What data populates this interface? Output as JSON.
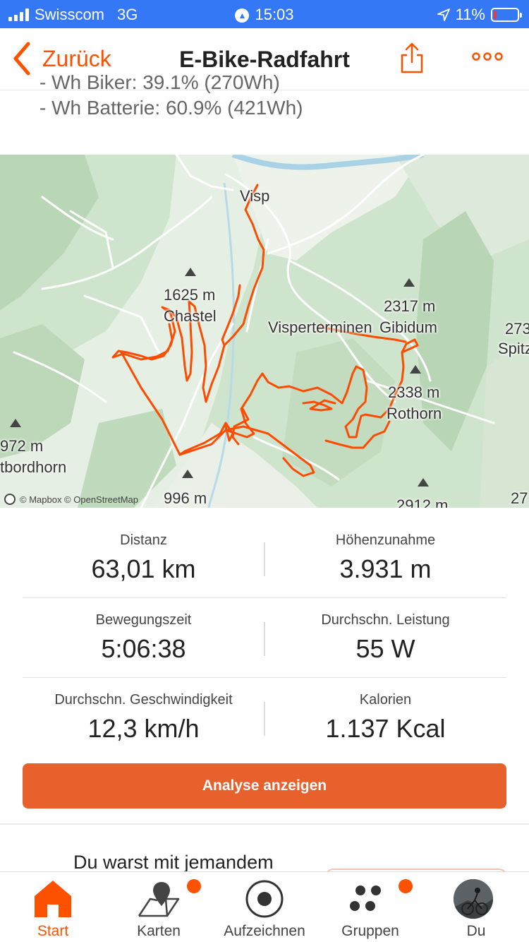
{
  "status_bar": {
    "carrier": "Swisscom",
    "network": "3G",
    "time": "15:03",
    "battery": "11%",
    "battery_level": 0.11,
    "battery_color": "#e63b3b"
  },
  "nav": {
    "back_label": "Zurück",
    "title": "E-Bike-Radfahrt",
    "share_icon": "share-icon",
    "more_icon": "more-icon"
  },
  "description": {
    "line1": "- Wh Biker: 39.1% (270Wh)",
    "line2": "- Wh Batterie: 60.9% (421Wh)"
  },
  "map": {
    "route_color": "#fc4c02",
    "labels": {
      "visp": "Visp",
      "peak_1625": "1625 m",
      "chastel": "Chastel",
      "visperterminen": "Visperterminen",
      "peak_2317": "2317 m",
      "gibidum": "Gibidum",
      "peak_273": "273",
      "spitz": "Spitz",
      "peak_2338": "2338 m",
      "rothorn": "Rothorn",
      "peak_972": "972 m",
      "bordhorn": "tbordhorn",
      "peak_996": "996 m",
      "peak_2912": "2912 m",
      "peak_27": "27"
    },
    "attribution": "© Mapbox © OpenStreetMap"
  },
  "stats": [
    {
      "left_label": "Distanz",
      "left_value": "63,01 km",
      "right_label": "Höhenzunahme",
      "right_value": "3.931 m"
    },
    {
      "left_label": "Bewegungszeit",
      "left_value": "5:06:38",
      "right_label": "Durchschn. Leistung",
      "right_value": "55 W"
    },
    {
      "left_label": "Durchschn. Geschwindigkeit",
      "left_value": "12,3 km/h",
      "right_label": "Kalorien",
      "right_value": "1.137 Kcal"
    }
  ],
  "analyse_button": "Analyse anzeigen",
  "together_text": "Du warst mit jemandem",
  "tabs": [
    {
      "label": "Start",
      "icon": "home-icon",
      "active": true
    },
    {
      "label": "Karten",
      "icon": "map-icon",
      "badge": true
    },
    {
      "label": "Aufzeichnen",
      "icon": "record-icon"
    },
    {
      "label": "Gruppen",
      "icon": "groups-icon",
      "badge": true
    },
    {
      "label": "Du",
      "icon": "avatar"
    }
  ],
  "colors": {
    "accent": "#fc5200",
    "button": "#e8602c",
    "status_bar": "#3478f6"
  }
}
